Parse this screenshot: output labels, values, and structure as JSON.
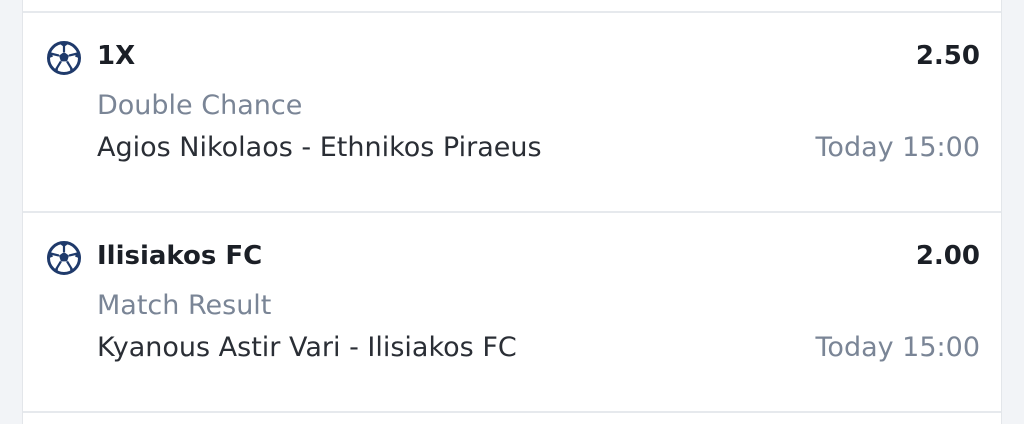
{
  "bets": [
    {
      "selection": "1X",
      "odds": "2.50",
      "market": "Double Chance",
      "event": "Agios Nikolaos - Ethnikos Piraeus",
      "time": "Today 15:00",
      "icon": "soccer-ball-icon"
    },
    {
      "selection": "Ilisiakos FC",
      "odds": "2.00",
      "market": "Match Result",
      "event": "Kyanous Astir Vari - Ilisiakos FC",
      "time": "Today 15:00",
      "icon": "soccer-ball-icon"
    }
  ],
  "colors": {
    "icon": "#1f3a6b",
    "text_primary": "#1b1f26",
    "text_secondary": "#7a8596"
  }
}
